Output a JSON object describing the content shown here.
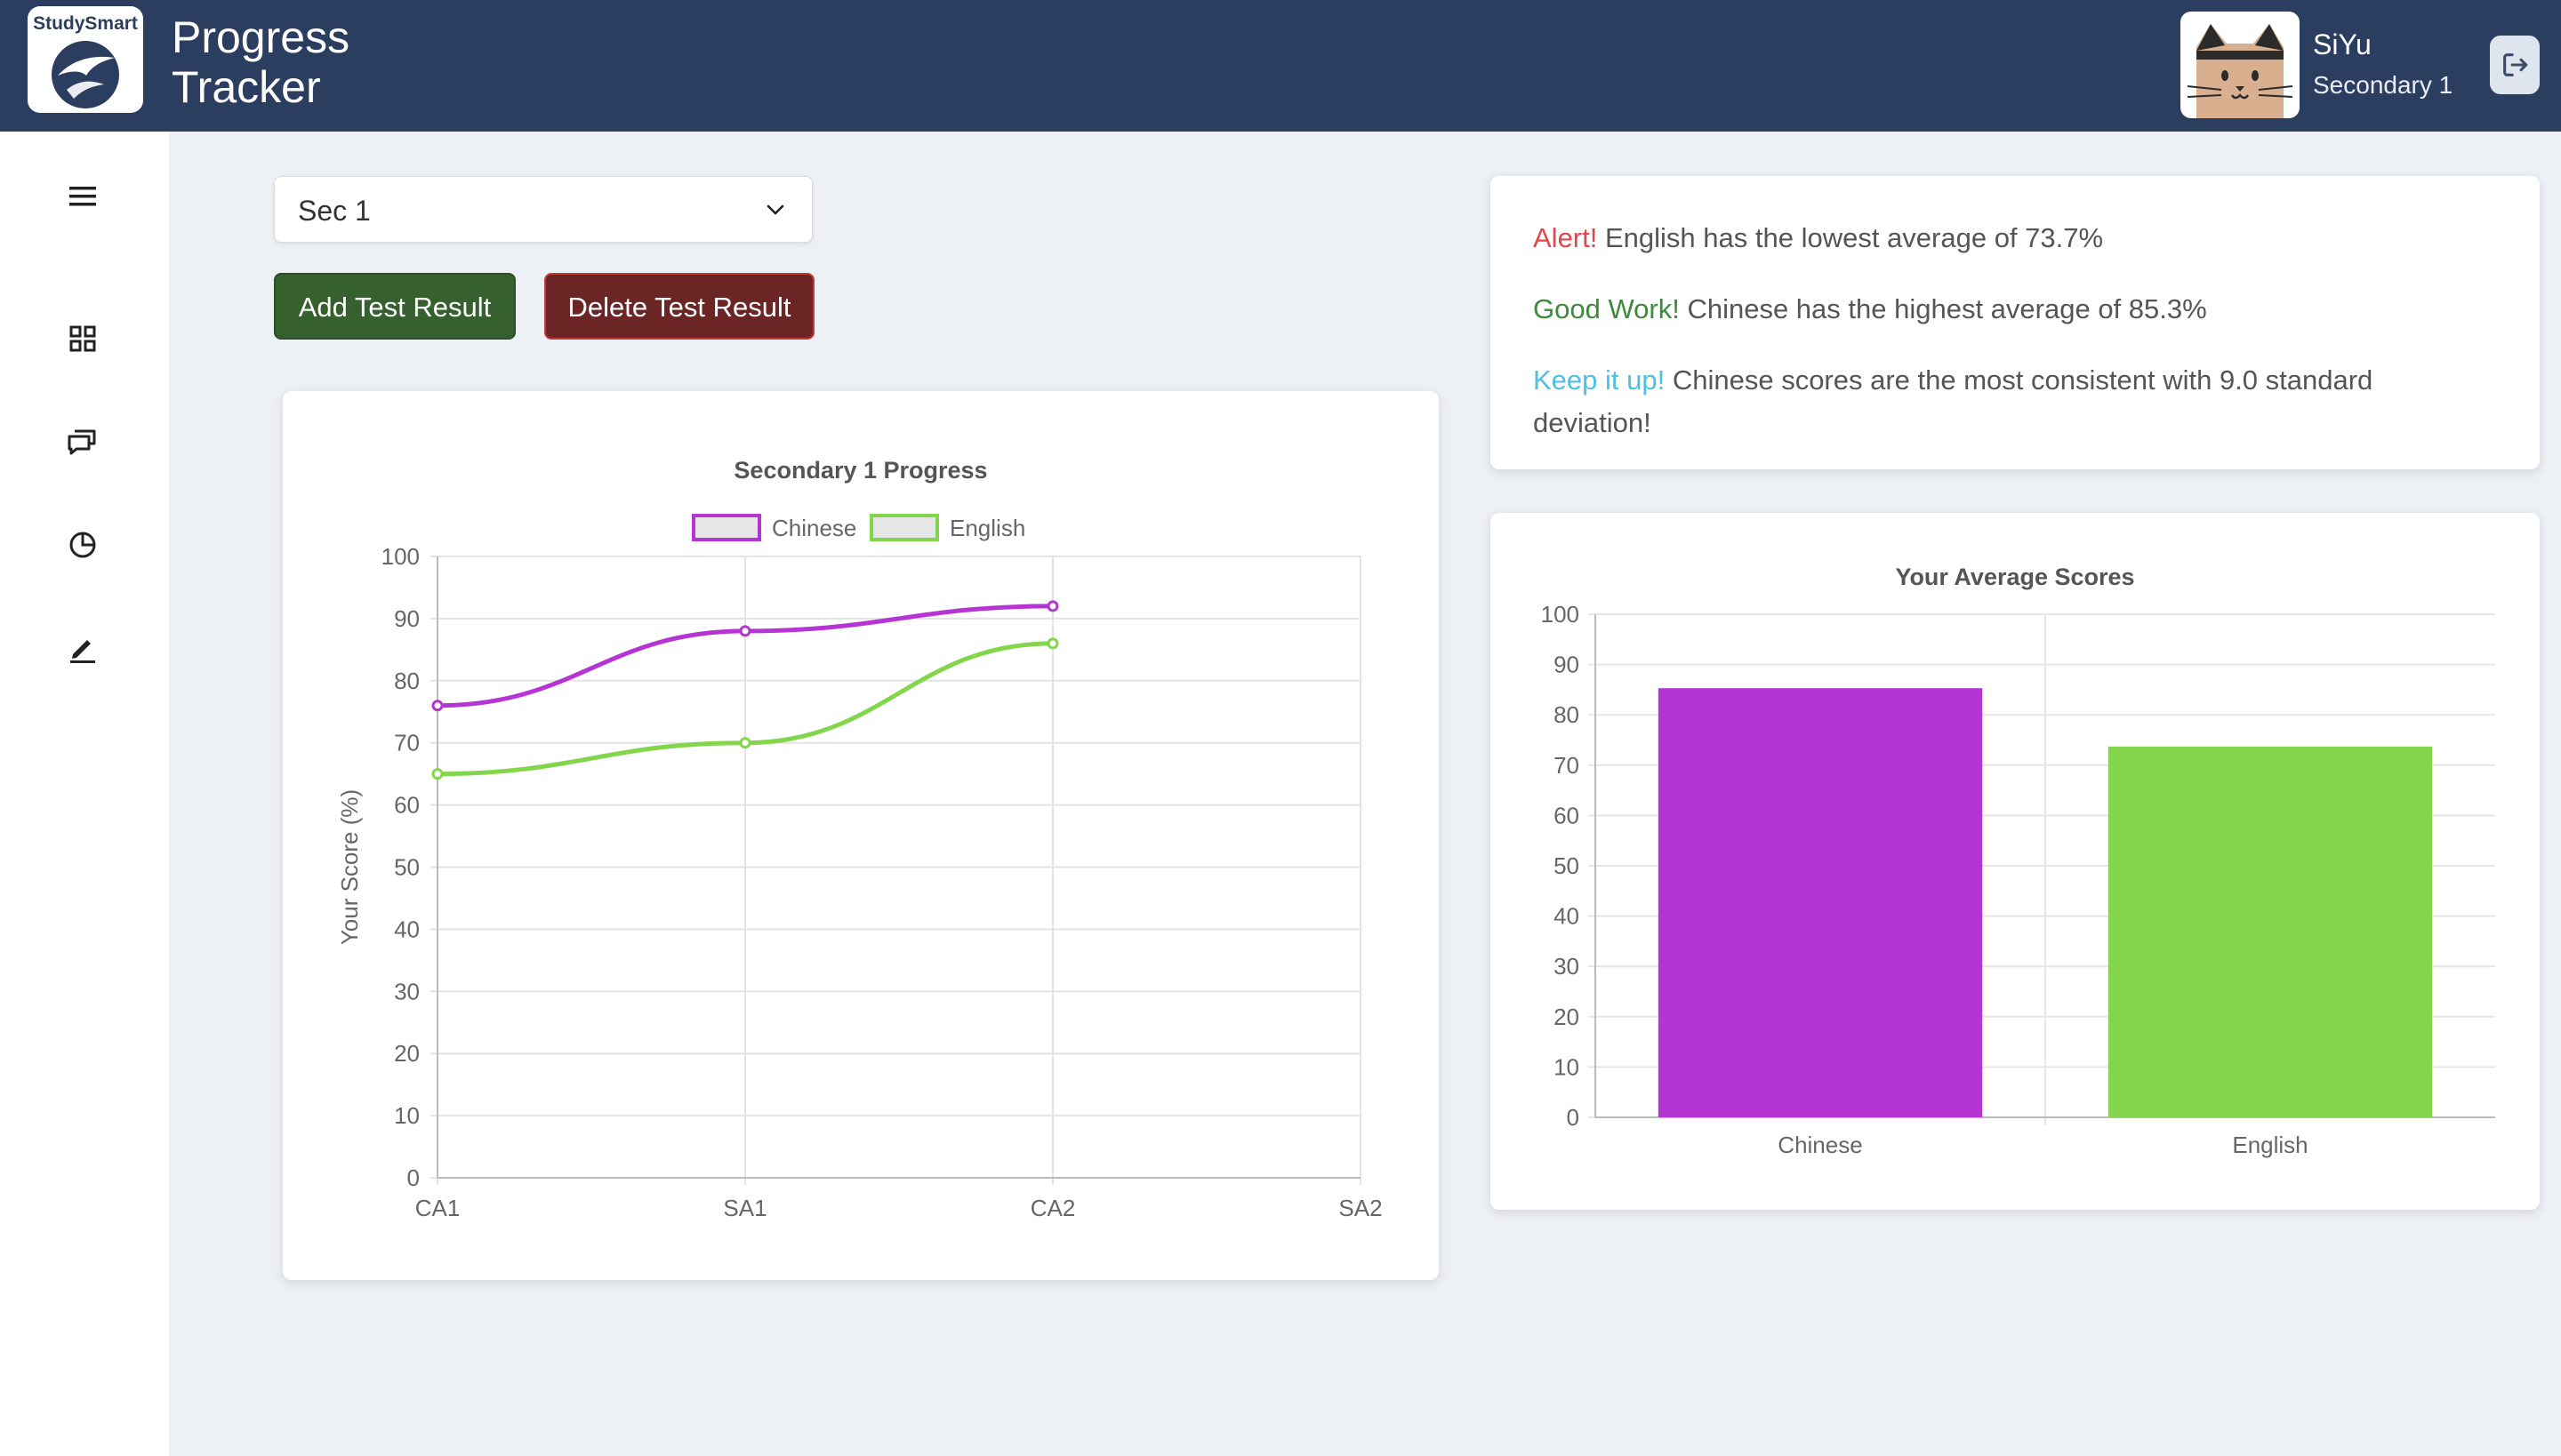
{
  "header": {
    "logo_text": "StudySmart",
    "title_line1": "Progress",
    "title_line2": "Tracker",
    "user_name": "SiYu",
    "user_level": "Secondary 1"
  },
  "controls": {
    "level_select_value": "Sec 1",
    "add_button": "Add Test Result",
    "delete_button": "Delete Test Result"
  },
  "alerts": [
    {
      "label": "Alert!",
      "text": "English has the lowest average of 73.7%"
    },
    {
      "label": "Good Work!",
      "text": "Chinese has the highest average of 85.3%"
    },
    {
      "label": "Keep it up!",
      "text": "Chinese scores are the most consistent with 9.0 standard deviation!"
    }
  ],
  "colors": {
    "header_bg": "#2c3e5f",
    "chinese": "#b535d4",
    "english": "#83d64b",
    "alert": "#e0464a",
    "good": "#3e8a3b",
    "keep": "#4ec0e3"
  },
  "chart_data": [
    {
      "type": "line",
      "title": "Secondary 1 Progress",
      "xlabel": "",
      "ylabel": "Your Score (%)",
      "categories": [
        "CA1",
        "SA1",
        "CA2",
        "SA2"
      ],
      "ylim": [
        0,
        100
      ],
      "yticks": [
        "0",
        "10",
        "20",
        "30",
        "40",
        "50",
        "60",
        "70",
        "80",
        "90",
        "100"
      ],
      "legend_position": "top",
      "grid": true,
      "series": [
        {
          "name": "Chinese",
          "color": "#b535d4",
          "values": [
            76,
            88,
            92,
            null
          ]
        },
        {
          "name": "English",
          "color": "#83d64b",
          "values": [
            65,
            70,
            86,
            null
          ]
        }
      ]
    },
    {
      "type": "bar",
      "title": "Your Average Scores",
      "categories": [
        "Chinese",
        "English"
      ],
      "values": [
        85.3,
        73.7
      ],
      "colors": [
        "#b535d4",
        "#83d64b"
      ],
      "ylim": [
        0,
        100
      ],
      "yticks": [
        "0",
        "10",
        "20",
        "30",
        "40",
        "50",
        "60",
        "70",
        "80",
        "90",
        "100"
      ],
      "grid": true
    }
  ]
}
